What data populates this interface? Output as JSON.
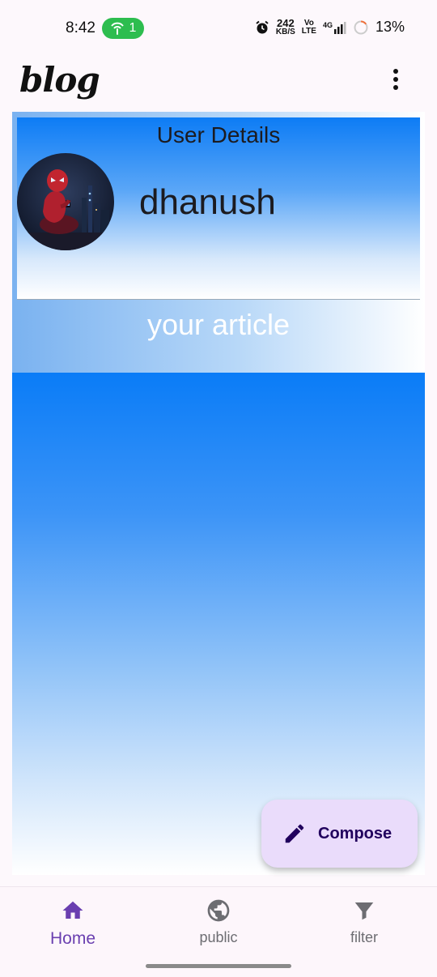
{
  "status_bar": {
    "time": "8:42",
    "hotspot_count": "1",
    "network_speed_top": "242",
    "network_speed_bottom": "KB/S",
    "volte_top": "Vo",
    "volte_bottom": "LTE",
    "network_type": "4G",
    "battery": "13%"
  },
  "app_bar": {
    "title": "blog",
    "more_icon": "more-vert-icon"
  },
  "user_card": {
    "title": "User Details",
    "name": "dhanush",
    "avatar_icon": "spiderman-avatar"
  },
  "article": {
    "label": "your article"
  },
  "fab": {
    "label": "Compose",
    "icon": "pencil-icon"
  },
  "bottom_nav": {
    "items": [
      {
        "label": "Home",
        "icon": "home-icon",
        "active": true
      },
      {
        "label": "public",
        "icon": "globe-icon",
        "active": false
      },
      {
        "label": "filter",
        "icon": "filter-icon",
        "active": false
      }
    ]
  },
  "colors": {
    "accent": "#6a3fb0",
    "fab_background": "#eadcfb",
    "header_blue": "#0d7cf5"
  }
}
